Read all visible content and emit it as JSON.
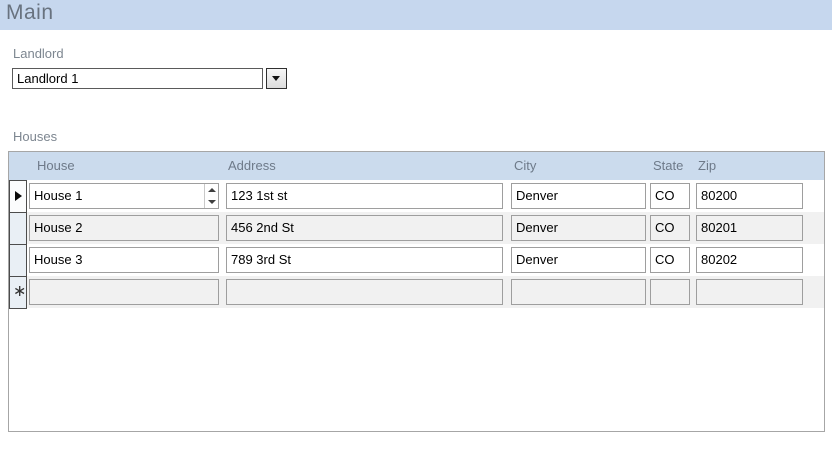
{
  "page": {
    "title": "Main"
  },
  "landlord": {
    "label": "Landlord",
    "value": "Landlord 1"
  },
  "houses": {
    "label": "Houses",
    "columns": [
      "House",
      "Address",
      "City",
      "State",
      "Zip"
    ],
    "rows": [
      {
        "house": "House 1",
        "address": "123 1st st",
        "city": "Denver",
        "state": "CO",
        "zip": "80200"
      },
      {
        "house": "House 2",
        "address": "456 2nd St",
        "city": "Denver",
        "state": "CO",
        "zip": "80201"
      },
      {
        "house": "House 3",
        "address": "789 3rd St",
        "city": "Denver",
        "state": "CO",
        "zip": "80202"
      }
    ],
    "new_record_marker": "∗"
  },
  "colors": {
    "titlebar": "#c6d7ee",
    "datasheet_header": "#cbdbed",
    "alt_row": "#f1f1f1"
  }
}
